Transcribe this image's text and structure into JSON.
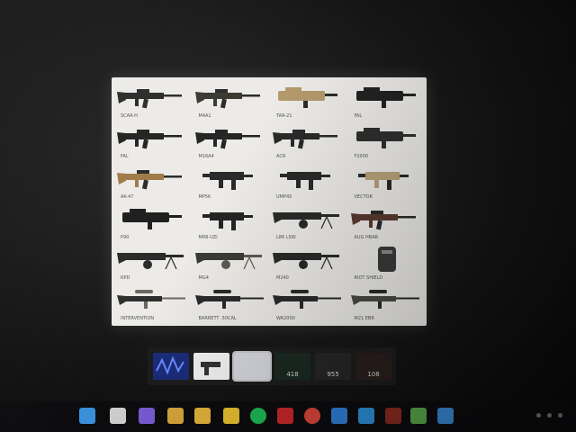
{
  "viewer": {
    "weapons": [
      {
        "label": "SCAR-H",
        "color": "#2b2b2b",
        "accent": "#2b2b2b",
        "shape": "rifle"
      },
      {
        "label": "M4A1",
        "color": "#3a3a33",
        "accent": "#2b2b2b",
        "shape": "rifle"
      },
      {
        "label": "TAR-21",
        "color": "#b49a6b",
        "accent": "#2b2b2b",
        "shape": "bullpup"
      },
      {
        "label": "FAL",
        "color": "#222222",
        "accent": "#222222",
        "shape": "bullpup"
      },
      {
        "label": "FAL",
        "color": "#222222",
        "accent": "#222222",
        "shape": "rifle"
      },
      {
        "label": "M16A4",
        "color": "#252525",
        "accent": "#252525",
        "shape": "rifle"
      },
      {
        "label": "ACR",
        "color": "#2a2a2a",
        "accent": "#2a2a2a",
        "shape": "rifle"
      },
      {
        "label": "F2000",
        "color": "#2f2f2f",
        "accent": "#2f2f2f",
        "shape": "bullpup"
      },
      {
        "label": "AK-47",
        "color": "#a07a48",
        "accent": "#2a2a2a",
        "shape": "rifle"
      },
      {
        "label": "MP5K",
        "color": "#2a2a2a",
        "accent": "#2a2a2a",
        "shape": "smg"
      },
      {
        "label": "UMP45",
        "color": "#2a2a2a",
        "accent": "#2a2a2a",
        "shape": "smg"
      },
      {
        "label": "VECTOR",
        "color": "#b9a27a",
        "accent": "#2a2a2a",
        "shape": "smg"
      },
      {
        "label": "P90",
        "color": "#1e1e1e",
        "accent": "#1e1e1e",
        "shape": "bullpup"
      },
      {
        "label": "MINI-UZI",
        "color": "#252525",
        "accent": "#252525",
        "shape": "smg"
      },
      {
        "label": "L86 LSW",
        "color": "#2a2a2a",
        "accent": "#2a2a2a",
        "shape": "lmg"
      },
      {
        "label": "AUG HBAR",
        "color": "#5a3a30",
        "accent": "#2a2a2a",
        "shape": "rifle"
      },
      {
        "label": "RPD",
        "color": "#2a2a2a",
        "accent": "#2a2a2a",
        "shape": "lmg"
      },
      {
        "label": "MG4",
        "color": "#3a3a36",
        "accent": "#5a5a50",
        "shape": "lmg"
      },
      {
        "label": "M240",
        "color": "#2a2a2a",
        "accent": "#2a2a2a",
        "shape": "lmg"
      },
      {
        "label": "RIOT SHIELD",
        "color": "#3a3a3a",
        "accent": "#8a8a8a",
        "shape": "shield"
      },
      {
        "label": "INTERVENTION",
        "color": "#2e2e2e",
        "accent": "#6a6a60",
        "shape": "sniper"
      },
      {
        "label": "BARRETT .50CAL",
        "color": "#2a2a2a",
        "accent": "#2a2a2a",
        "shape": "sniper"
      },
      {
        "label": "WA2000",
        "color": "#2a2a2a",
        "accent": "#2a2a2a",
        "shape": "sniper"
      },
      {
        "label": "M21 EBR",
        "color": "#4a4a42",
        "accent": "#2a2a2a",
        "shape": "sniper"
      }
    ]
  },
  "thumbnails": [
    {
      "name": "thumb-blue",
      "bg": "#1b2c7a",
      "caption": ""
    },
    {
      "name": "thumb-pistol",
      "bg": "#f4f4f4",
      "caption": ""
    },
    {
      "name": "thumb-white",
      "bg": "#d8d8e0",
      "caption": ""
    },
    {
      "name": "thumb-dark-1",
      "bg": "#1a2a22",
      "caption": "418"
    },
    {
      "name": "thumb-dark-2",
      "bg": "#262626",
      "caption": "955"
    },
    {
      "name": "thumb-dark-3",
      "bg": "#2a1e1e",
      "caption": "108"
    }
  ],
  "taskbar": {
    "icons": [
      {
        "name": "start-icon",
        "color": "#3a8fd9"
      },
      {
        "name": "task-view-icon",
        "color": "#cfcfcf"
      },
      {
        "name": "app-purple-icon",
        "color": "#7a5bd6"
      },
      {
        "name": "file-explorer-icon",
        "color": "#d9a73a"
      },
      {
        "name": "folder-icon",
        "color": "#e3b43c"
      },
      {
        "name": "notes-icon",
        "color": "#e8c030"
      },
      {
        "name": "spotify-icon",
        "color": "#1db954"
      },
      {
        "name": "app-red-icon",
        "color": "#c8282a"
      },
      {
        "name": "chrome-icon",
        "color": "#d9453a"
      },
      {
        "name": "app-blue-icon",
        "color": "#2f7fd6"
      },
      {
        "name": "vscode-icon",
        "color": "#2d8fd9"
      },
      {
        "name": "app-dark-red-icon",
        "color": "#8a2a20"
      },
      {
        "name": "app-green-icon",
        "color": "#5aa84a"
      },
      {
        "name": "app-teal-icon",
        "color": "#3a8ad6"
      }
    ]
  }
}
